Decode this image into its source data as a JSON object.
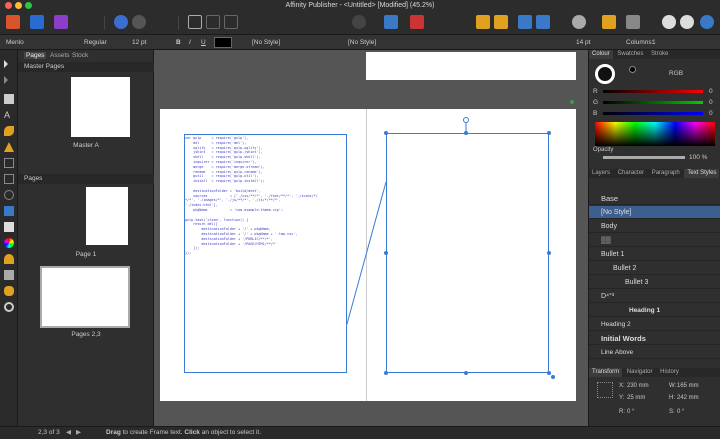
{
  "window": {
    "title": "Affinity Publisher - <Untitled> [Modified] (45.2%)"
  },
  "context_bar": {
    "font": "Menlo",
    "style": "Regular",
    "size": "12 pt",
    "bold": "B",
    "italic": "I",
    "underline": "U",
    "char_style": "[No Style]",
    "para_style": "[No Style]",
    "line_size": "14 pt",
    "columns_label": "Columns:",
    "columns_value": "1"
  },
  "pages_panel": {
    "tabs": [
      "Pages",
      "Assets",
      "Stock"
    ],
    "master_pages_label": "Master Pages",
    "master_a": "Master A",
    "pages_label": "Pages",
    "page_1": "Page 1",
    "pages_2_3": "Pages 2,3"
  },
  "right_panel": {
    "tabs": [
      "Colour",
      "Swatches",
      "Stroke"
    ],
    "color_model": "RGB",
    "channels": [
      "R",
      "G",
      "B"
    ],
    "channel_values": [
      "0",
      "0",
      "0"
    ],
    "opacity_label": "Opacity",
    "opacity_value": "100 %",
    "style_tabs": [
      "Layers",
      "Character",
      "Paragraph",
      "Text Styles"
    ],
    "styles": [
      {
        "label": "Base"
      },
      {
        "label": "[No Style]"
      },
      {
        "label": "Body"
      },
      {
        "label": "▒▒"
      },
      {
        "label": "Bullet 1"
      },
      {
        "label": "Bullet 2"
      },
      {
        "label": "Bullet 3"
      },
      {
        "label": "D⁴°³"
      },
      {
        "label": "Heading 1"
      },
      {
        "label": "Heading 2"
      },
      {
        "label": "Initial Words"
      },
      {
        "label": "Line Above"
      }
    ],
    "transform_tabs": [
      "Transform",
      "Navigator",
      "History"
    ],
    "transform": {
      "x_label": "X:",
      "x": "230 mm",
      "w_label": "W:",
      "w": "165 mm",
      "y_label": "Y:",
      "y": "25 mm",
      "h_label": "H:",
      "h": "242 mm",
      "r_label": "R:",
      "r": "0 °",
      "s_label": "S:",
      "s": "0 °"
    }
  },
  "status_bar": {
    "page_indicator": "2,3 of 3",
    "hint_bold1": "Drag",
    "hint1": " to create Frame text. ",
    "hint_bold2": "Click",
    "hint2": " an object to select it."
  },
  "document_code": "var gulp     = require('gulp'),\n    del      = require('del'),\n    uglify   = require('gulp-uglify'),\n    jshint   = require('gulp-jshint'),\n    shell    = require('gulp-shell'),\n    inquirer = require('inquirer'),\n    merge    = require('merge-stream'),\n    rename   = require('gulp-rename'),\n    gutil    = require('gulp-util'),\n    install  = require('gulp-install');\n\n    destinationFolder = 'build/dest',\n    sources           = ['./css/**/*', './font/**/*', './icons/*/\n*/*', './images/*', './js/**/*', './js/*/**/*',\n'./index.html'],\n    pkgName           = 'com.example.theme.zip';\n\ngulp.task('clean', function() {\n    return del([\n        destinationFolder + '/' + pkgName,\n        destinationFolder + '/' + pkgName + '.tmp.css',\n        destinationFolder + '/PUBLIC/**/*',\n        destinationFolder + '/PAGE/HTML/**/*'\n    ]);\n});",
  "colors": {
    "accent": "#3a78c8",
    "selected_row": "#3d5f8f",
    "frame_blue": "#3a7bd5"
  }
}
